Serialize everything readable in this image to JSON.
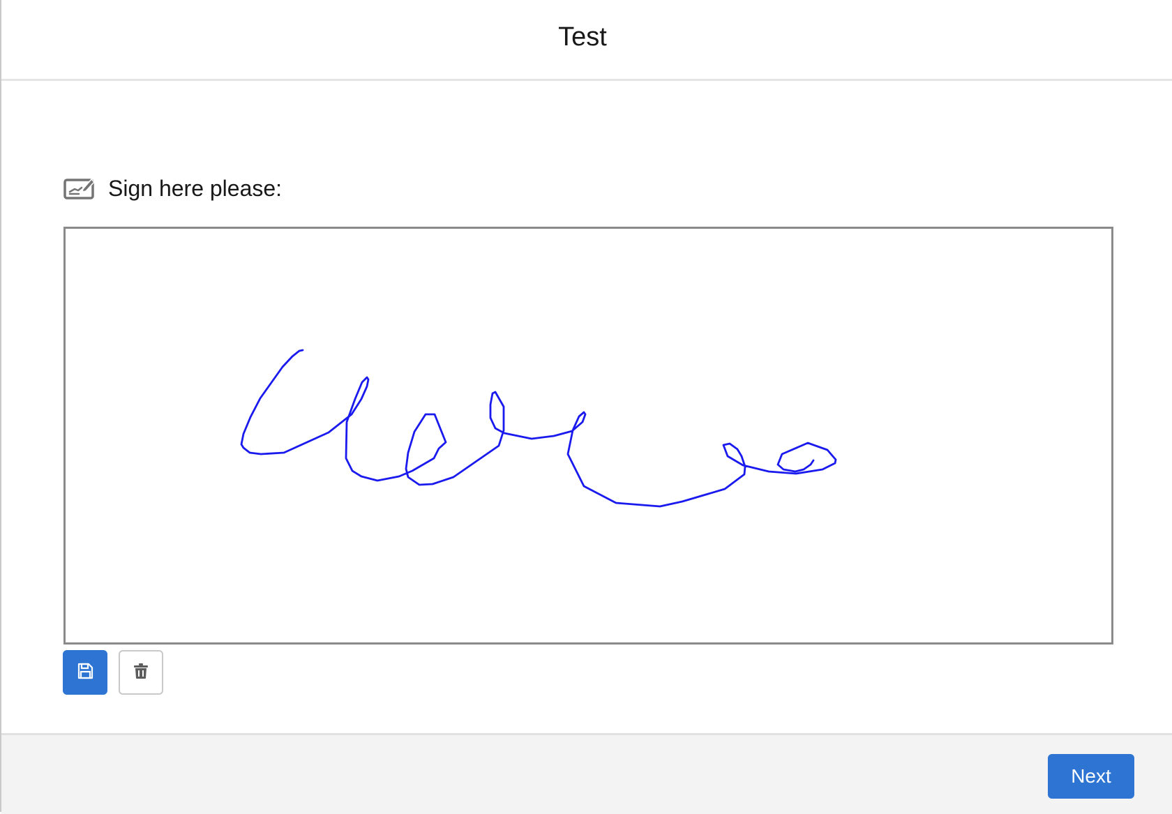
{
  "header": {
    "title": "Test"
  },
  "signature": {
    "icon": "signature-pad-icon",
    "label": "Sign here please:",
    "ink_color": "#1a1aee",
    "save_icon": "save-icon",
    "clear_icon": "trash-icon"
  },
  "footer": {
    "next_label": "Next"
  },
  "colors": {
    "brand": "#2e74d3",
    "canvas_border": "#8a8a8a",
    "footer_bg": "#f3f3f3"
  }
}
